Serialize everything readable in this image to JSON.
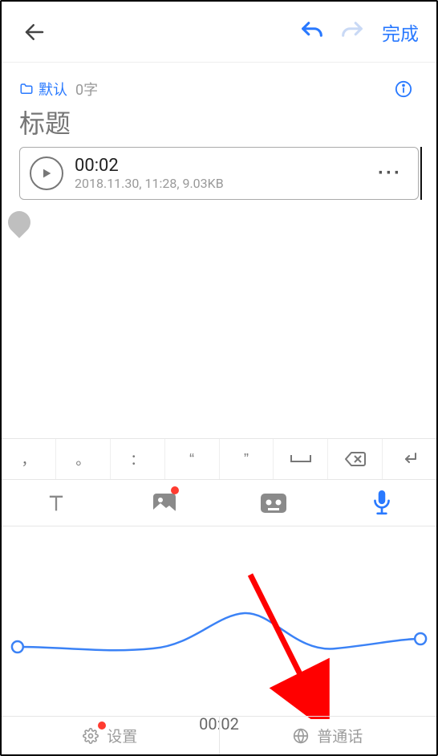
{
  "topbar": {
    "done_label": "完成"
  },
  "meta": {
    "folder_label": "默认",
    "word_count": "0字"
  },
  "title": {
    "placeholder": "标题"
  },
  "audio": {
    "duration": "00:02",
    "meta": "2018.11.30, 11:28, 9.03KB",
    "more_label": "···"
  },
  "punct": {
    "comma": "，",
    "period": "。",
    "colon": "：",
    "open_quote": "“",
    "close_quote": "”"
  },
  "recorder": {
    "elapsed": "00:02"
  },
  "bottom": {
    "settings_label": "设置",
    "language_label": "普通话"
  }
}
